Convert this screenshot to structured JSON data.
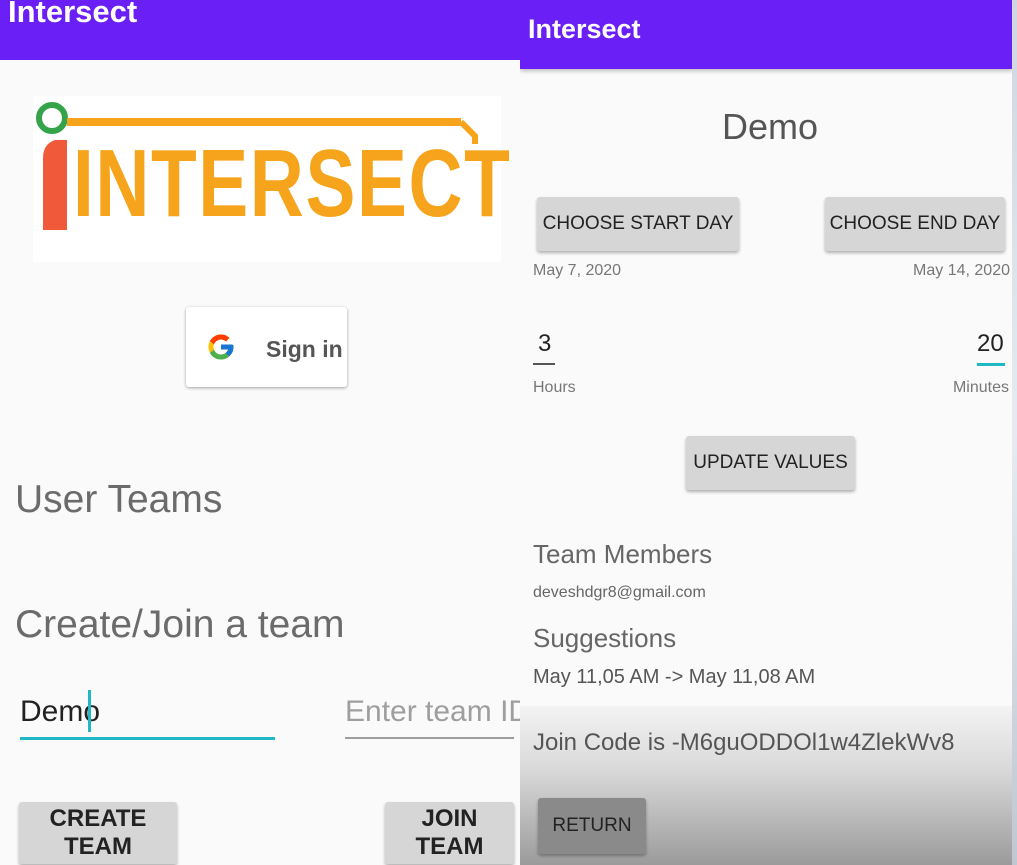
{
  "left": {
    "app_title": "Intersect",
    "logo_text": "INTERSECT",
    "signin_label": "Sign in",
    "user_teams_heading": "User Teams",
    "create_join_heading": "Create/Join a team",
    "team_name_value": "Demo",
    "team_id_placeholder": "Enter team ID:",
    "create_team_label": "CREATE TEAM",
    "join_team_label": "JOIN TEAM"
  },
  "right": {
    "app_title": "Intersect",
    "team_title": "Demo",
    "choose_start_label": "CHOOSE START DAY",
    "choose_end_label": "CHOOSE END DAY",
    "start_date": "May 7, 2020",
    "end_date": "May 14, 2020",
    "hours_value": "3",
    "minutes_value": "20",
    "hours_label": "Hours",
    "minutes_label": "Minutes",
    "update_label": "UPDATE VALUES",
    "team_members_heading": "Team Members",
    "member_email": "deveshdgr8@gmail.com",
    "suggestions_heading": "Suggestions",
    "suggestion_text": "May 11,05 AM -> May 11,08 AM",
    "join_code_text": "Join Code is -M6guODDOl1w4ZlekWv8",
    "return_label": "RETURN"
  },
  "colors": {
    "appbar": "#6b1ff7",
    "accent": "#1fb8c4",
    "logo_orange": "#f6a41b",
    "logo_red": "#f05a3a",
    "logo_green": "#35a34a",
    "button_grey": "#d6d6d6"
  },
  "icons": [
    "google-g-icon",
    "intersect-logo"
  ]
}
